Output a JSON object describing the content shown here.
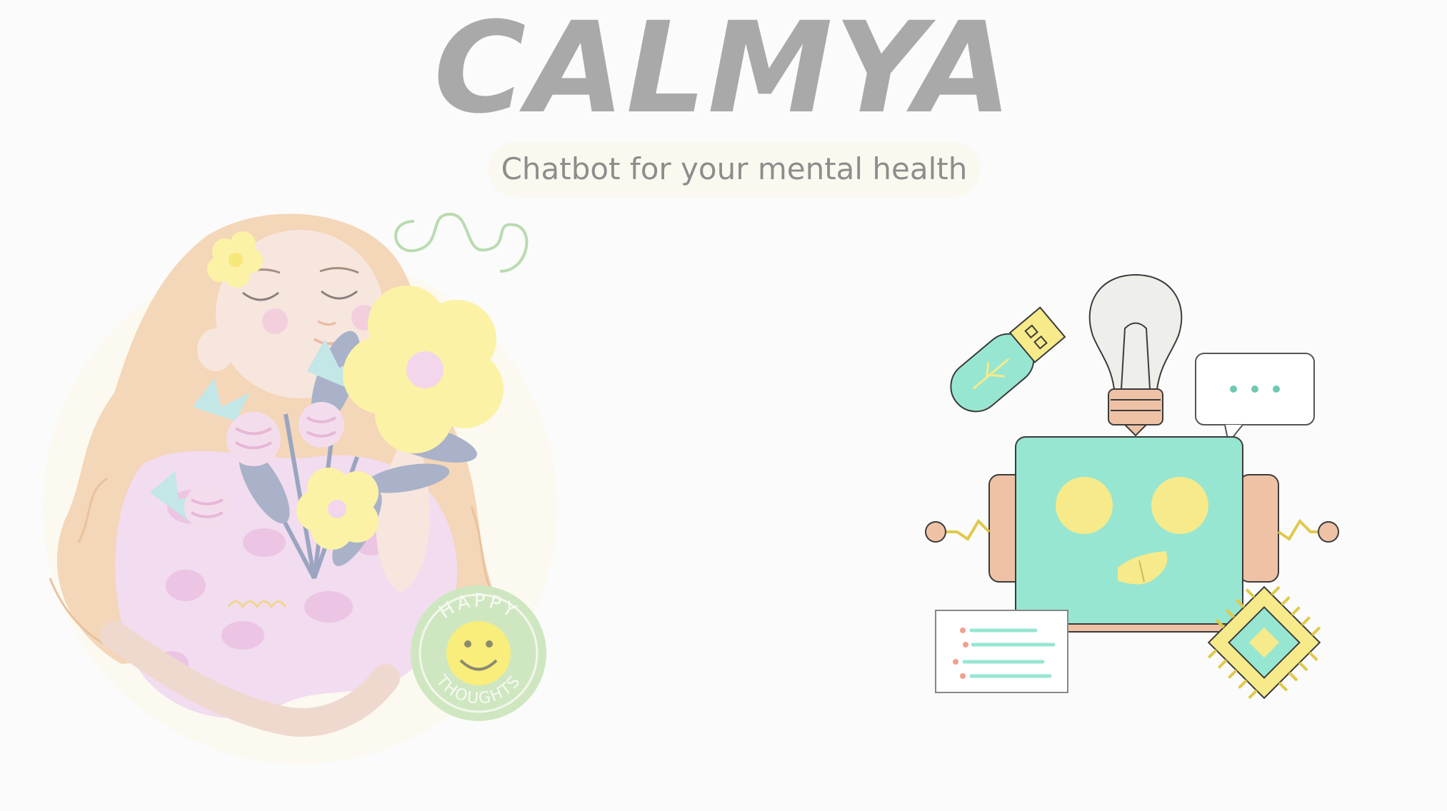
{
  "app": {
    "title": "CALMYA",
    "subtitle": "Chatbot for your mental health"
  },
  "illustrations": {
    "woman": {
      "badge_top": "HAPPY",
      "badge_bottom": "THOUGHTS"
    },
    "robot": {
      "icons": [
        "usb-icon",
        "lightbulb-icon",
        "speech-bubble-icon",
        "chip-icon",
        "list-card-icon"
      ]
    }
  },
  "colors": {
    "background": "#fafbfa",
    "title": "#a9a9a9",
    "subtitle": "#8d8d8d",
    "robot_teal": "#97e6d2",
    "robot_yellow": "#f6ea8a",
    "robot_peach": "#efc2a6",
    "hair": "#f3d4b5",
    "dress_pink": "#f0d8ef",
    "flower_yellow": "#fbf2a6"
  }
}
